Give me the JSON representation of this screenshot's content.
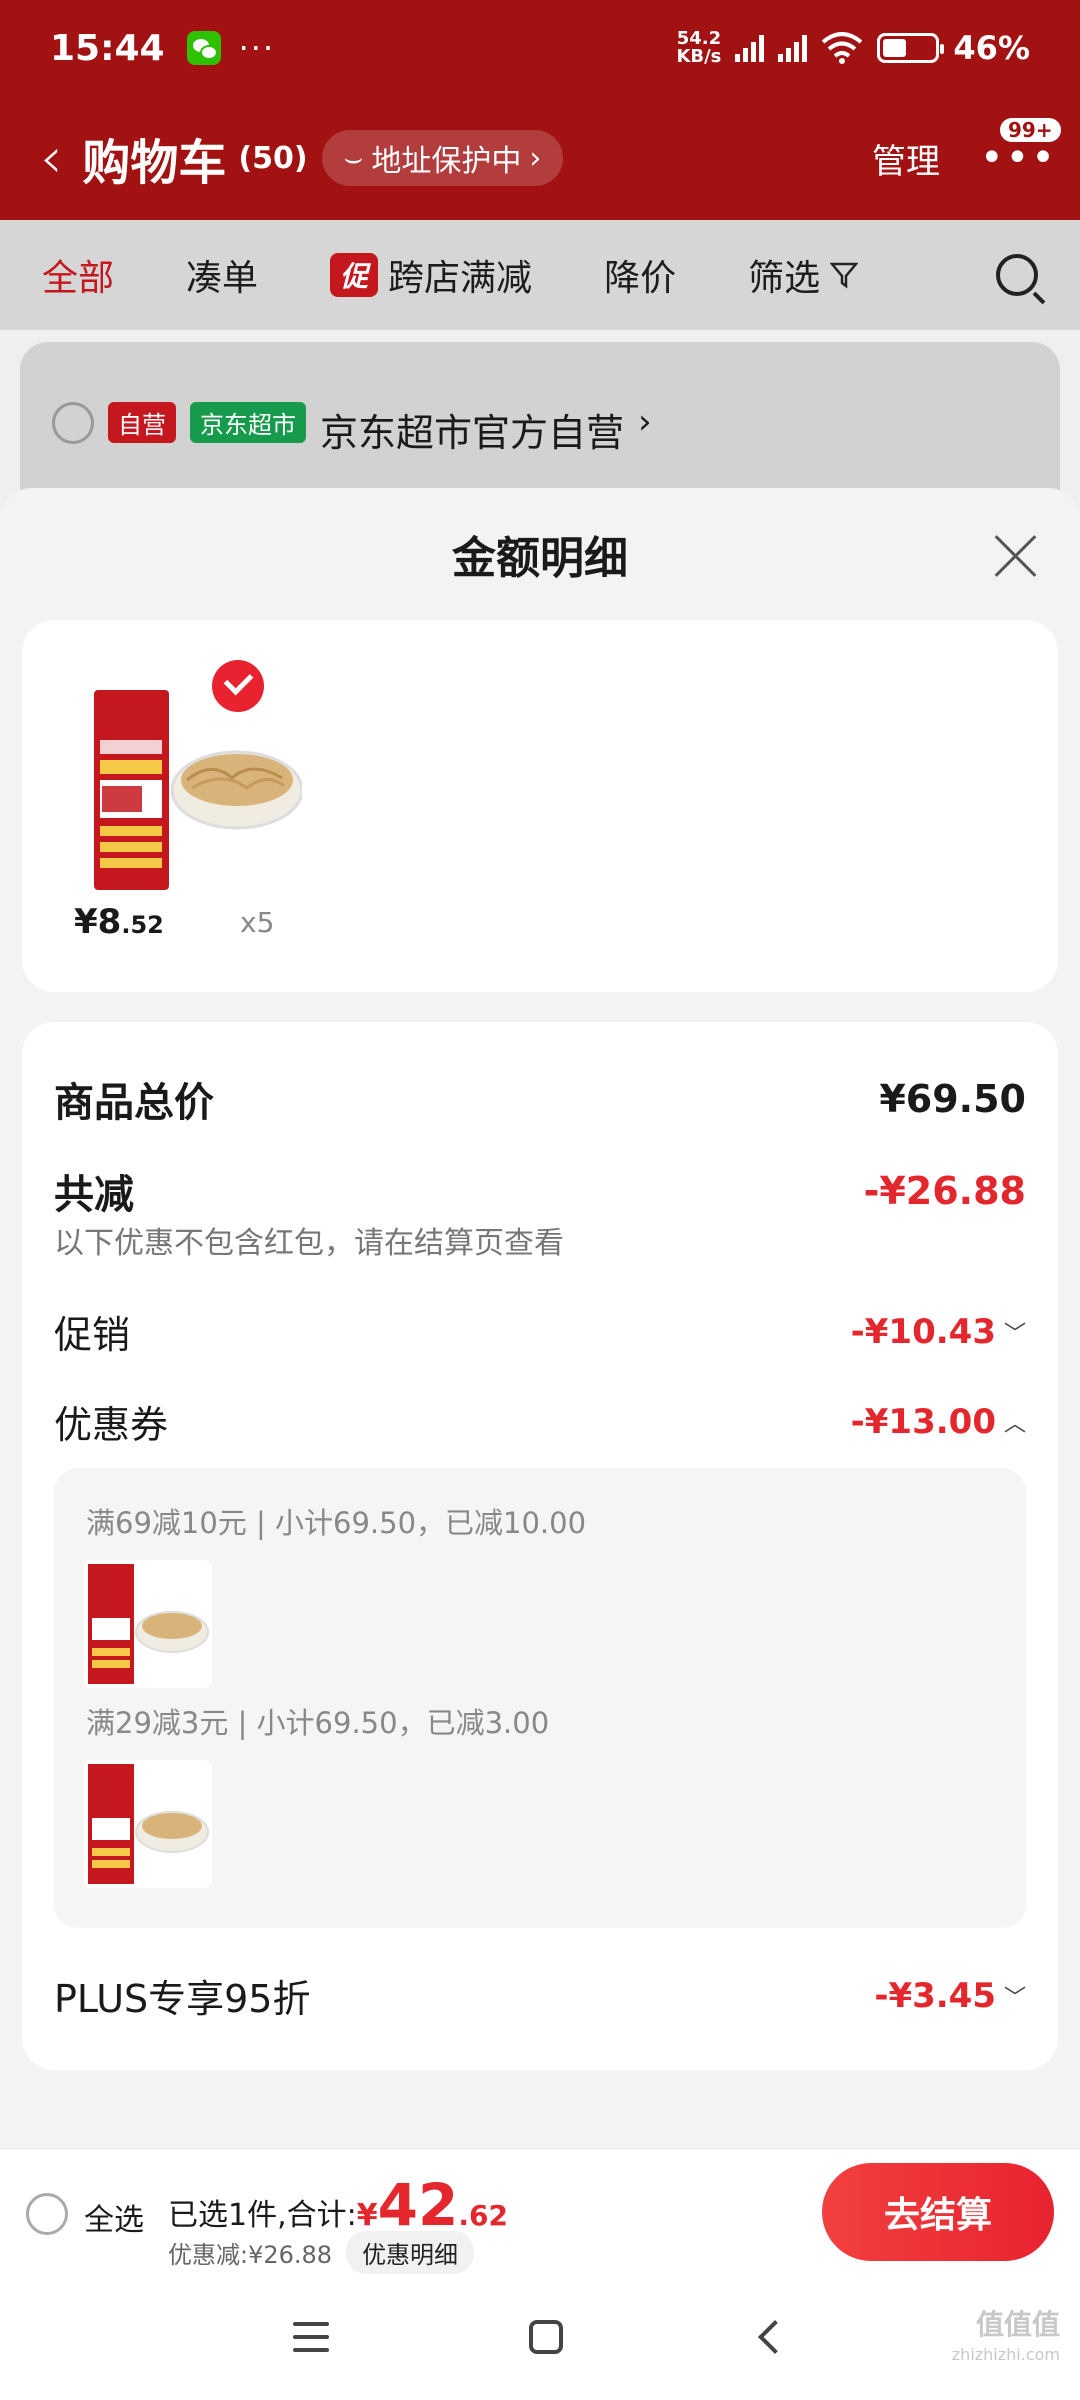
{
  "status_bar": {
    "time": "15:44",
    "net_speed_value": "54.2",
    "net_speed_unit": "KB/s",
    "battery": "46%"
  },
  "header": {
    "title": "购物车",
    "count": "(50)",
    "address_badge": "地址保护中",
    "manage": "管理",
    "more_badge": "99+"
  },
  "filters": {
    "all": "全部",
    "bundle": "凑单",
    "promo_tag": "促",
    "cross_store": "跨店满减",
    "price_drop": "降价",
    "filter": "筛选"
  },
  "shop": {
    "tag_self": "自营",
    "tag_market": "京东超市",
    "name": "京东超市官方自营"
  },
  "sheet": {
    "title": "金额明细",
    "item": {
      "price_main": "¥8",
      "price_decimal": ".52",
      "quantity": "x5"
    },
    "total_label": "商品总价",
    "total_value": "¥69.50",
    "reduction_label": "共减",
    "reduction_value": "-¥26.88",
    "reduction_note": "以下优惠不包含红包，请在结算页查看",
    "promo_label": "促销",
    "promo_value": "-¥10.43",
    "coupon_label": "优惠券",
    "coupon_value": "-¥13.00",
    "coupons": [
      {
        "desc": "满69减10元 | 小计69.50，已减10.00"
      },
      {
        "desc": "满29减3元 | 小计69.50，已减3.00"
      }
    ],
    "plus_label": "PLUS专享95折",
    "plus_value": "-¥3.45"
  },
  "action_bar": {
    "select_all": "全选",
    "selected_text": "已选1件,合计:",
    "currency": "¥",
    "total_int": "42",
    "total_dec": ".62",
    "discount_text": "优惠减:¥26.88",
    "detail_chip": "优惠明细",
    "checkout": "去结算"
  },
  "watermark": {
    "site": "值值值",
    "url": "zhizhizhi.com"
  },
  "colors": {
    "brand_red": "#a31212",
    "price_red": "#e4262d",
    "market_green": "#159b4b"
  }
}
